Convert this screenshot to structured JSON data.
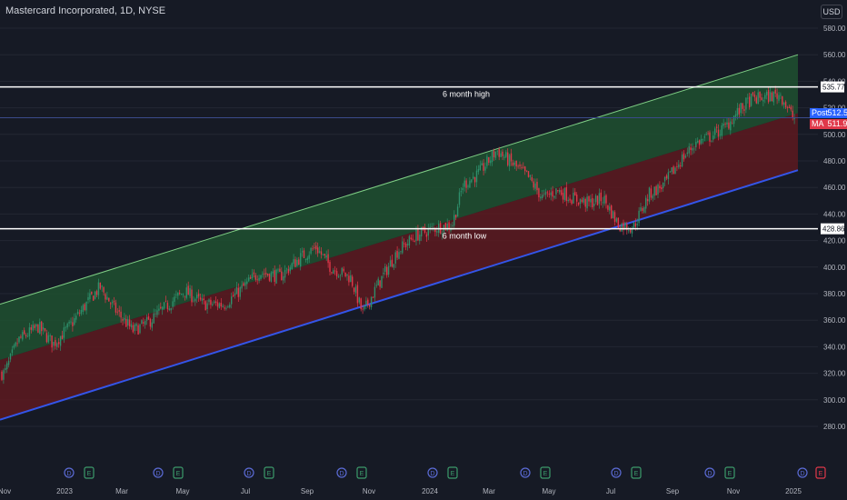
{
  "header": {
    "title": "Mastercard Incorporated, 1D, NYSE",
    "currency": "USD"
  },
  "colors": {
    "background": "#161a25",
    "upper_band": "#1e5130",
    "lower_band": "#5d1a20",
    "channel_bottom_line": "#3455e8",
    "channel_top_line": "#7fcf85",
    "up_candle": "#2e8f6b",
    "down_candle": "#e0384a",
    "post_tag": "#2962ff",
    "ma_tag": "#e0384a"
  },
  "price_tags": {
    "post_label": "Post",
    "post_value": "512.50",
    "ma_label": "MA",
    "ma_value": "511.93"
  },
  "annotations": {
    "high_label": "6 month high",
    "high_value": "535.77",
    "low_label": "6 month low",
    "low_value": "428.86"
  },
  "event_icons": [
    "dividend-icon",
    "earnings-icon"
  ],
  "chart_data": {
    "type": "candlestick",
    "y_axis": {
      "range": [
        270,
        590
      ],
      "ticks": [
        280,
        300,
        320,
        340,
        360,
        380,
        400,
        420,
        440,
        460,
        480,
        500,
        520,
        540,
        560,
        580
      ]
    },
    "x_axis_labels": [
      "Nov",
      "2023",
      "Mar",
      "May",
      "Jul",
      "Sep",
      "Nov",
      "2024",
      "Mar",
      "May",
      "Jul",
      "Sep",
      "Nov",
      "2025"
    ],
    "horizontal_levels": [
      {
        "label": "6 month high",
        "value": 535.77
      },
      {
        "label": "6 month low",
        "value": 428.86
      }
    ],
    "regression_channel": {
      "top": {
        "start": 372,
        "end": 560
      },
      "middle": {
        "start": 330,
        "end": 516
      },
      "bottom": {
        "start": 285,
        "end": 473
      }
    },
    "close_path": [
      {
        "date": "2022-11-01",
        "close": 320
      },
      {
        "date": "2022-11-15",
        "close": 345
      },
      {
        "date": "2022-12-05",
        "close": 355
      },
      {
        "date": "2022-12-20",
        "close": 342
      },
      {
        "date": "2023-01-05",
        "close": 355
      },
      {
        "date": "2023-01-25",
        "close": 375
      },
      {
        "date": "2023-02-05",
        "close": 385
      },
      {
        "date": "2023-02-20",
        "close": 368
      },
      {
        "date": "2023-03-10",
        "close": 352
      },
      {
        "date": "2023-03-25",
        "close": 358
      },
      {
        "date": "2023-04-15",
        "close": 372
      },
      {
        "date": "2023-05-01",
        "close": 382
      },
      {
        "date": "2023-05-20",
        "close": 372
      },
      {
        "date": "2023-06-10",
        "close": 372
      },
      {
        "date": "2023-06-25",
        "close": 382
      },
      {
        "date": "2023-07-15",
        "close": 396
      },
      {
        "date": "2023-08-05",
        "close": 393
      },
      {
        "date": "2023-08-25",
        "close": 407
      },
      {
        "date": "2023-09-10",
        "close": 415
      },
      {
        "date": "2023-09-25",
        "close": 400
      },
      {
        "date": "2023-10-15",
        "close": 392
      },
      {
        "date": "2023-10-27",
        "close": 365
      },
      {
        "date": "2023-11-10",
        "close": 385
      },
      {
        "date": "2023-12-01",
        "close": 412
      },
      {
        "date": "2023-12-20",
        "close": 424
      },
      {
        "date": "2024-01-10",
        "close": 430
      },
      {
        "date": "2024-01-25",
        "close": 432
      },
      {
        "date": "2024-02-05",
        "close": 462
      },
      {
        "date": "2024-02-20",
        "close": 470
      },
      {
        "date": "2024-03-10",
        "close": 488
      },
      {
        "date": "2024-03-25",
        "close": 478
      },
      {
        "date": "2024-04-10",
        "close": 468
      },
      {
        "date": "2024-04-25",
        "close": 452
      },
      {
        "date": "2024-05-10",
        "close": 458
      },
      {
        "date": "2024-05-25",
        "close": 452
      },
      {
        "date": "2024-06-10",
        "close": 448
      },
      {
        "date": "2024-06-25",
        "close": 452
      },
      {
        "date": "2024-07-10",
        "close": 432
      },
      {
        "date": "2024-07-25",
        "close": 430
      },
      {
        "date": "2024-08-10",
        "close": 455
      },
      {
        "date": "2024-08-25",
        "close": 462
      },
      {
        "date": "2024-09-10",
        "close": 480
      },
      {
        "date": "2024-09-25",
        "close": 493
      },
      {
        "date": "2024-10-10",
        "close": 498
      },
      {
        "date": "2024-10-25",
        "close": 505
      },
      {
        "date": "2024-11-05",
        "close": 515
      },
      {
        "date": "2024-11-20",
        "close": 526
      },
      {
        "date": "2024-12-05",
        "close": 528
      },
      {
        "date": "2024-12-20",
        "close": 530
      },
      {
        "date": "2025-01-02",
        "close": 512
      }
    ]
  }
}
